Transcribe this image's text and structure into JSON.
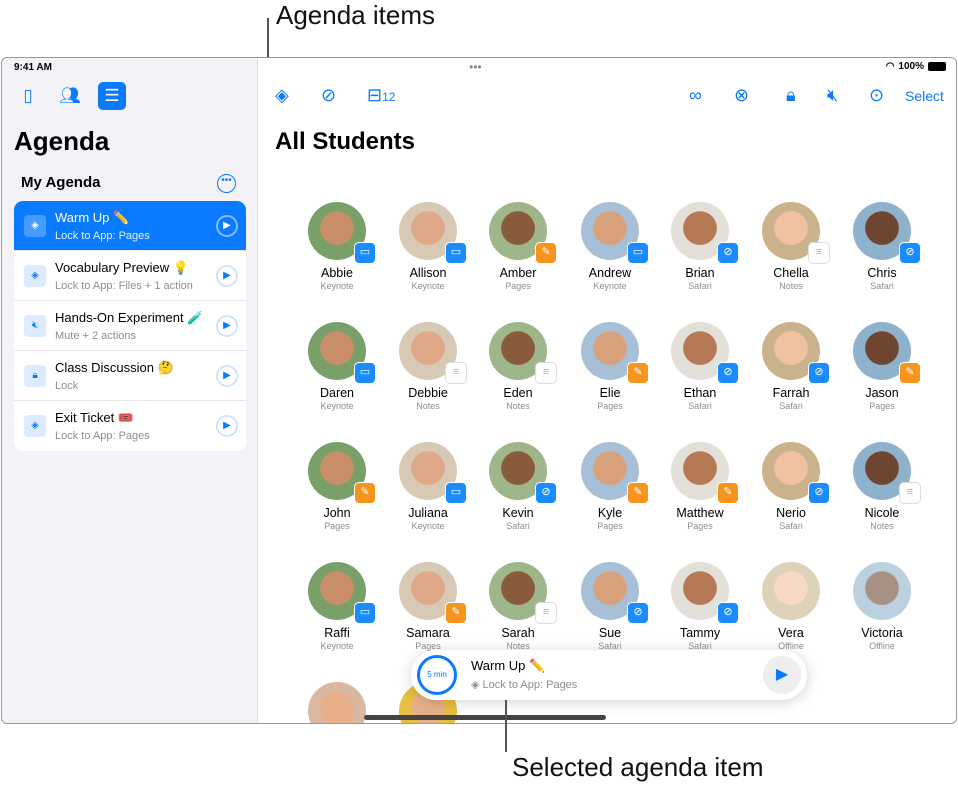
{
  "callouts": {
    "top": "Agenda items",
    "bottom": "Selected agenda item"
  },
  "status": {
    "time": "9:41 AM",
    "battery": "100%"
  },
  "sidebar": {
    "title": "Agenda",
    "section": "My Agenda",
    "items": [
      {
        "title": "Warm Up ✏️",
        "subtitle": "Lock to App: Pages",
        "icon": "layers-icon",
        "selected": true
      },
      {
        "title": "Vocabulary Preview 💡",
        "subtitle": "Lock to App: Files + 1 action",
        "icon": "layers-icon"
      },
      {
        "title": "Hands-On Experiment 🧪",
        "subtitle": "Mute + 2 actions",
        "icon": "mute-icon"
      },
      {
        "title": "Class Discussion 🤔",
        "subtitle": "Lock",
        "icon": "lock-icon"
      },
      {
        "title": "Exit Ticket 🎟️",
        "subtitle": "Lock to App: Pages",
        "icon": "layers-icon"
      }
    ]
  },
  "toolbar": {
    "inbox_count": "12",
    "select": "Select"
  },
  "main": {
    "title": "All Students"
  },
  "app_colors": {
    "Keynote": "#1a8cff",
    "Pages": "#f7941d",
    "Safari": "#1a8cff",
    "Notes": "#ffffff"
  },
  "students": [
    {
      "name": "Abbie",
      "app": "Keynote"
    },
    {
      "name": "Allison",
      "app": "Keynote"
    },
    {
      "name": "Amber",
      "app": "Pages"
    },
    {
      "name": "Andrew",
      "app": "Keynote"
    },
    {
      "name": "Brian",
      "app": "Safari"
    },
    {
      "name": "Chella",
      "app": "Notes"
    },
    {
      "name": "Chris",
      "app": "Safari"
    },
    {
      "name": "Daren",
      "app": "Keynote"
    },
    {
      "name": "Debbie",
      "app": "Notes"
    },
    {
      "name": "Eden",
      "app": "Notes"
    },
    {
      "name": "Elie",
      "app": "Pages"
    },
    {
      "name": "Ethan",
      "app": "Safari"
    },
    {
      "name": "Farrah",
      "app": "Safari"
    },
    {
      "name": "Jason",
      "app": "Pages"
    },
    {
      "name": "John",
      "app": "Pages"
    },
    {
      "name": "Juliana",
      "app": "Keynote"
    },
    {
      "name": "Kevin",
      "app": "Safari"
    },
    {
      "name": "Kyle",
      "app": "Pages"
    },
    {
      "name": "Matthew",
      "app": "Pages"
    },
    {
      "name": "Nerio",
      "app": "Safari"
    },
    {
      "name": "Nicole",
      "app": "Notes"
    },
    {
      "name": "Raffi",
      "app": "Keynote"
    },
    {
      "name": "Samara",
      "app": "Pages"
    },
    {
      "name": "Sarah",
      "app": "Notes"
    },
    {
      "name": "Sue",
      "app": "Safari"
    },
    {
      "name": "Tammy",
      "app": "Safari"
    },
    {
      "name": "Vera",
      "app": "Offline"
    },
    {
      "name": "Victoria",
      "app": "Offline"
    }
  ],
  "now_playing": {
    "timer": "5 min",
    "title": "Warm Up ✏️",
    "subtitle": "Lock to App: Pages"
  }
}
